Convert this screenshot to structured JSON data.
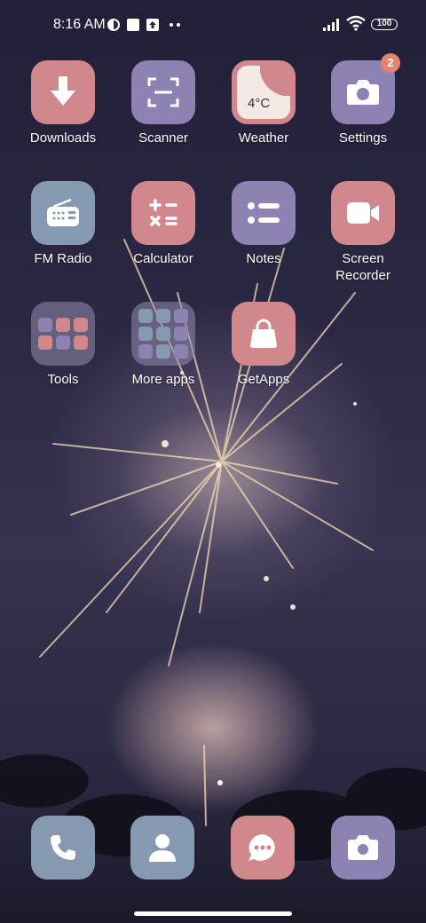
{
  "status_bar": {
    "time": "8:16 AM",
    "battery": "100"
  },
  "apps": {
    "downloads": {
      "label": "Downloads",
      "icon": "download-icon"
    },
    "scanner": {
      "label": "Scanner",
      "icon": "scan-icon"
    },
    "weather": {
      "label": "Weather",
      "temp": "4°C",
      "icon": "weather-icon"
    },
    "settings": {
      "label": "Settings",
      "badge": "2",
      "icon": "camera-gear-icon"
    },
    "fm_radio": {
      "label": "FM Radio",
      "icon": "radio-icon"
    },
    "calculator": {
      "label": "Calculator",
      "icon": "calculator-icon"
    },
    "notes": {
      "label": "Notes",
      "icon": "list-icon"
    },
    "screen_recorder": {
      "label": "Screen\nRecorder",
      "icon": "video-camera-icon"
    },
    "tools": {
      "label": "Tools",
      "icon": "folder-icon"
    },
    "more_apps": {
      "label": "More apps",
      "icon": "folder-icon"
    },
    "getapps": {
      "label": "GetApps",
      "icon": "shopping-bag-icon"
    }
  },
  "dock": {
    "phone": {
      "icon": "phone-icon"
    },
    "contacts": {
      "icon": "person-icon"
    },
    "messages": {
      "icon": "message-icon"
    },
    "camera": {
      "icon": "camera-icon"
    }
  },
  "colors": {
    "pink": "#d0888d",
    "purple": "#8d82b1",
    "blue": "#8599b0",
    "badge": "#e4846f"
  }
}
